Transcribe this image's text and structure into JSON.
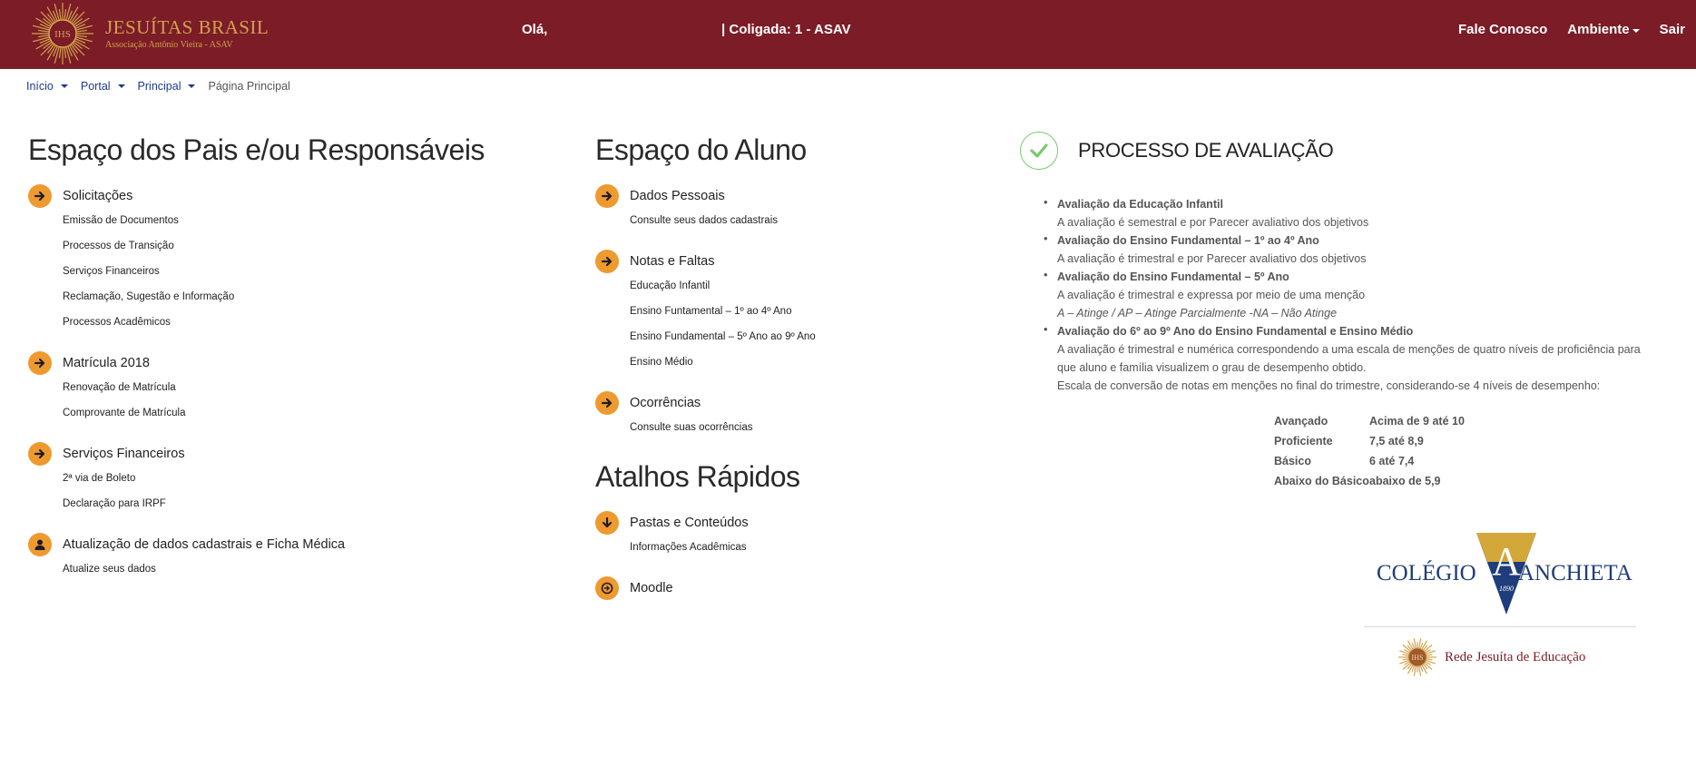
{
  "header": {
    "logo_title": "JESUÍTAS BRASIL",
    "logo_subtitle": "Associação Antônio Vieira - ASAV",
    "logo_monogram": "IHS",
    "greeting": "Olá,",
    "coligada": "|  Coligada: 1 - ASAV",
    "nav": {
      "contact": "Fale Conosco",
      "environment": "Ambiente",
      "logout": "Sair"
    },
    "colors": {
      "bar": "#7b1c27",
      "gold": "#d2a24c"
    }
  },
  "breadcrumb": {
    "items": [
      "Início",
      "Portal",
      "Principal"
    ],
    "current": "Página Principal"
  },
  "parents": {
    "title": "Espaço dos Pais e/ou Responsáveis",
    "groups": [
      {
        "label": "Solicitações",
        "icon": "arrow-right-icon",
        "items": [
          "Emissão de Documentos",
          "Processos de Transição",
          "Serviços Financeiros",
          "Reclamação, Sugestão e Informação",
          "Processos Acadêmicos"
        ]
      },
      {
        "label": "Matrícula 2018",
        "icon": "arrow-right-icon",
        "items": [
          "Renovação de Matrícula",
          "Comprovante de Matrícula"
        ]
      },
      {
        "label": "Serviços Financeiros",
        "icon": "arrow-right-icon",
        "items": [
          "2ª via de Boleto",
          "Declaração para IRPF"
        ]
      },
      {
        "label": "Atualização de dados cadastrais e Ficha Médica",
        "icon": "user-icon",
        "items": [
          "Atualize seus dados"
        ]
      }
    ]
  },
  "student": {
    "title": "Espaço do Aluno",
    "groups": [
      {
        "label": "Dados Pessoais",
        "icon": "arrow-right-icon",
        "items": [
          "Consulte seus dados cadastrais"
        ]
      },
      {
        "label": "Notas e Faltas",
        "icon": "arrow-right-icon",
        "items": [
          "Educação Infantil",
          "Ensino Funtamental – 1º ao 4º Ano",
          "Ensino Fundamental – 5º Ano ao 9º Ano",
          "Ensino Médio"
        ]
      },
      {
        "label": "Ocorrências",
        "icon": "arrow-right-icon",
        "items": [
          "Consulte suas ocorrências"
        ]
      }
    ]
  },
  "shortcuts": {
    "title": "Atalhos Rápidos",
    "groups": [
      {
        "label": "Pastas e Conteúdos",
        "icon": "arrow-down-icon",
        "items": [
          "Informações Acadêmicas"
        ]
      },
      {
        "label": "Moodle",
        "icon": "circle-arrow-icon",
        "items": []
      }
    ]
  },
  "evaluation": {
    "title": "PROCESSO DE AVALIAÇÃO",
    "icon": "check-circle-icon",
    "items": [
      {
        "title": "Avaliação da Educação Infantil",
        "lines": [
          "A avaliação é semestral e por Parecer avaliativo dos objetivos"
        ]
      },
      {
        "title": "Avaliação do Ensino Fundamental – 1º ao 4º Ano",
        "lines": [
          "A avaliação é trimestral e por Parecer avaliativo dos objetivos"
        ]
      },
      {
        "title": "Avaliação do Ensino Fundamental – 5º Ano",
        "lines": [
          "A avaliação é trimestral e expressa por meio de uma menção"
        ],
        "italic": "A – Atinge / AP – Atinge Parcialmente -NA – Não Atinge"
      },
      {
        "title": " Avaliação do 6º ao 9º Ano do Ensino Fundamental e Ensino Médio",
        "lines": [
          "A avaliação é trimestral e numérica correspondendo a uma escala de menções de quatro níveis de proficiência para",
          "que aluno e família visualizem o grau de desempenho obtido.",
          "Escala de conversão de notas em menções no final do trimestre, considerando-se 4 níveis de desempenho:"
        ]
      }
    ],
    "grades": [
      {
        "label": "Avançado",
        "range": "Acima de 9 até 10"
      },
      {
        "label": "Proficiente",
        "range": "7,5 até 8,9"
      },
      {
        "label": "Básico",
        "range": "6 até 7,4"
      },
      {
        "label": "Abaixo do Básico",
        "range": "abaixo de 5,9"
      }
    ]
  },
  "logos": {
    "school_left": "COLÉGIO",
    "school_right": "ANCHIETA",
    "school_year": "1890",
    "school_letter": "A",
    "network": "Rede Jesuíta de Educação",
    "network_monogram": "IHS",
    "colors": {
      "navy": "#1f3d7a",
      "gold": "#d4a73a"
    }
  }
}
